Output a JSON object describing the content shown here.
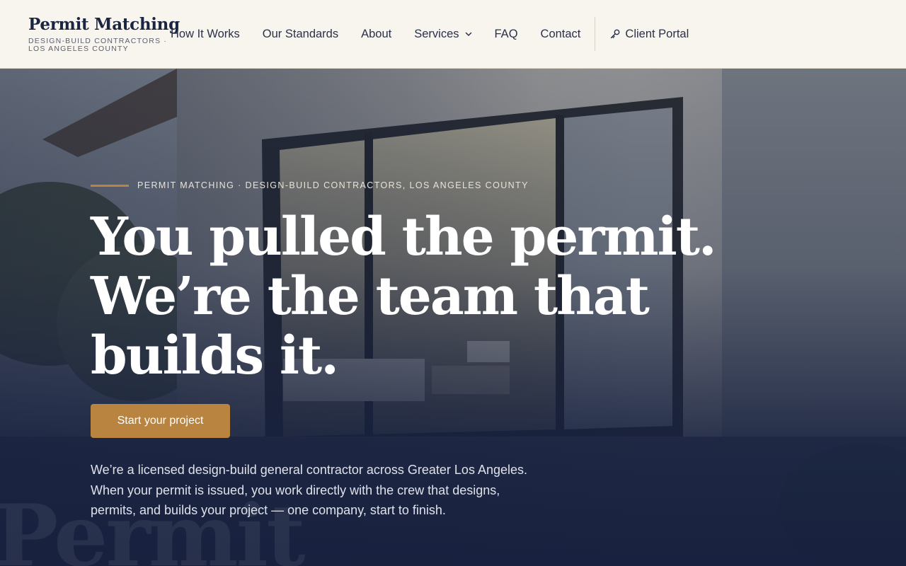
{
  "brand": {
    "name": "Permit Matching",
    "tagline": "DESIGN-BUILD CONTRACTORS · LOS ANGELES COUNTY"
  },
  "nav": {
    "items": [
      {
        "label": "How It Works"
      },
      {
        "label": "Our Standards"
      },
      {
        "label": "About"
      },
      {
        "label": "Services",
        "icon": "chevron-down-icon"
      },
      {
        "label": "FAQ"
      },
      {
        "label": "Contact"
      }
    ],
    "portal_label": "Client Portal",
    "portal_icon": "key-icon"
  },
  "hero": {
    "eyebrow": "PERMIT MATCHING · DESIGN-BUILD CONTRACTORS, LOS ANGELES COUNTY",
    "headline": "You pulled the permit. We’re the team that builds it.",
    "cta_label": "Start your project",
    "lede": "We’re a licensed design-build general contractor across Greater Los Angeles. When your permit is issued, you work directly with the crew that designs, permits, and builds your project — one company, start to finish.",
    "watermark": "Permit"
  },
  "colors": {
    "accent": "#b8843f",
    "navy": "#1b2540",
    "cream": "#f8f4ee"
  }
}
